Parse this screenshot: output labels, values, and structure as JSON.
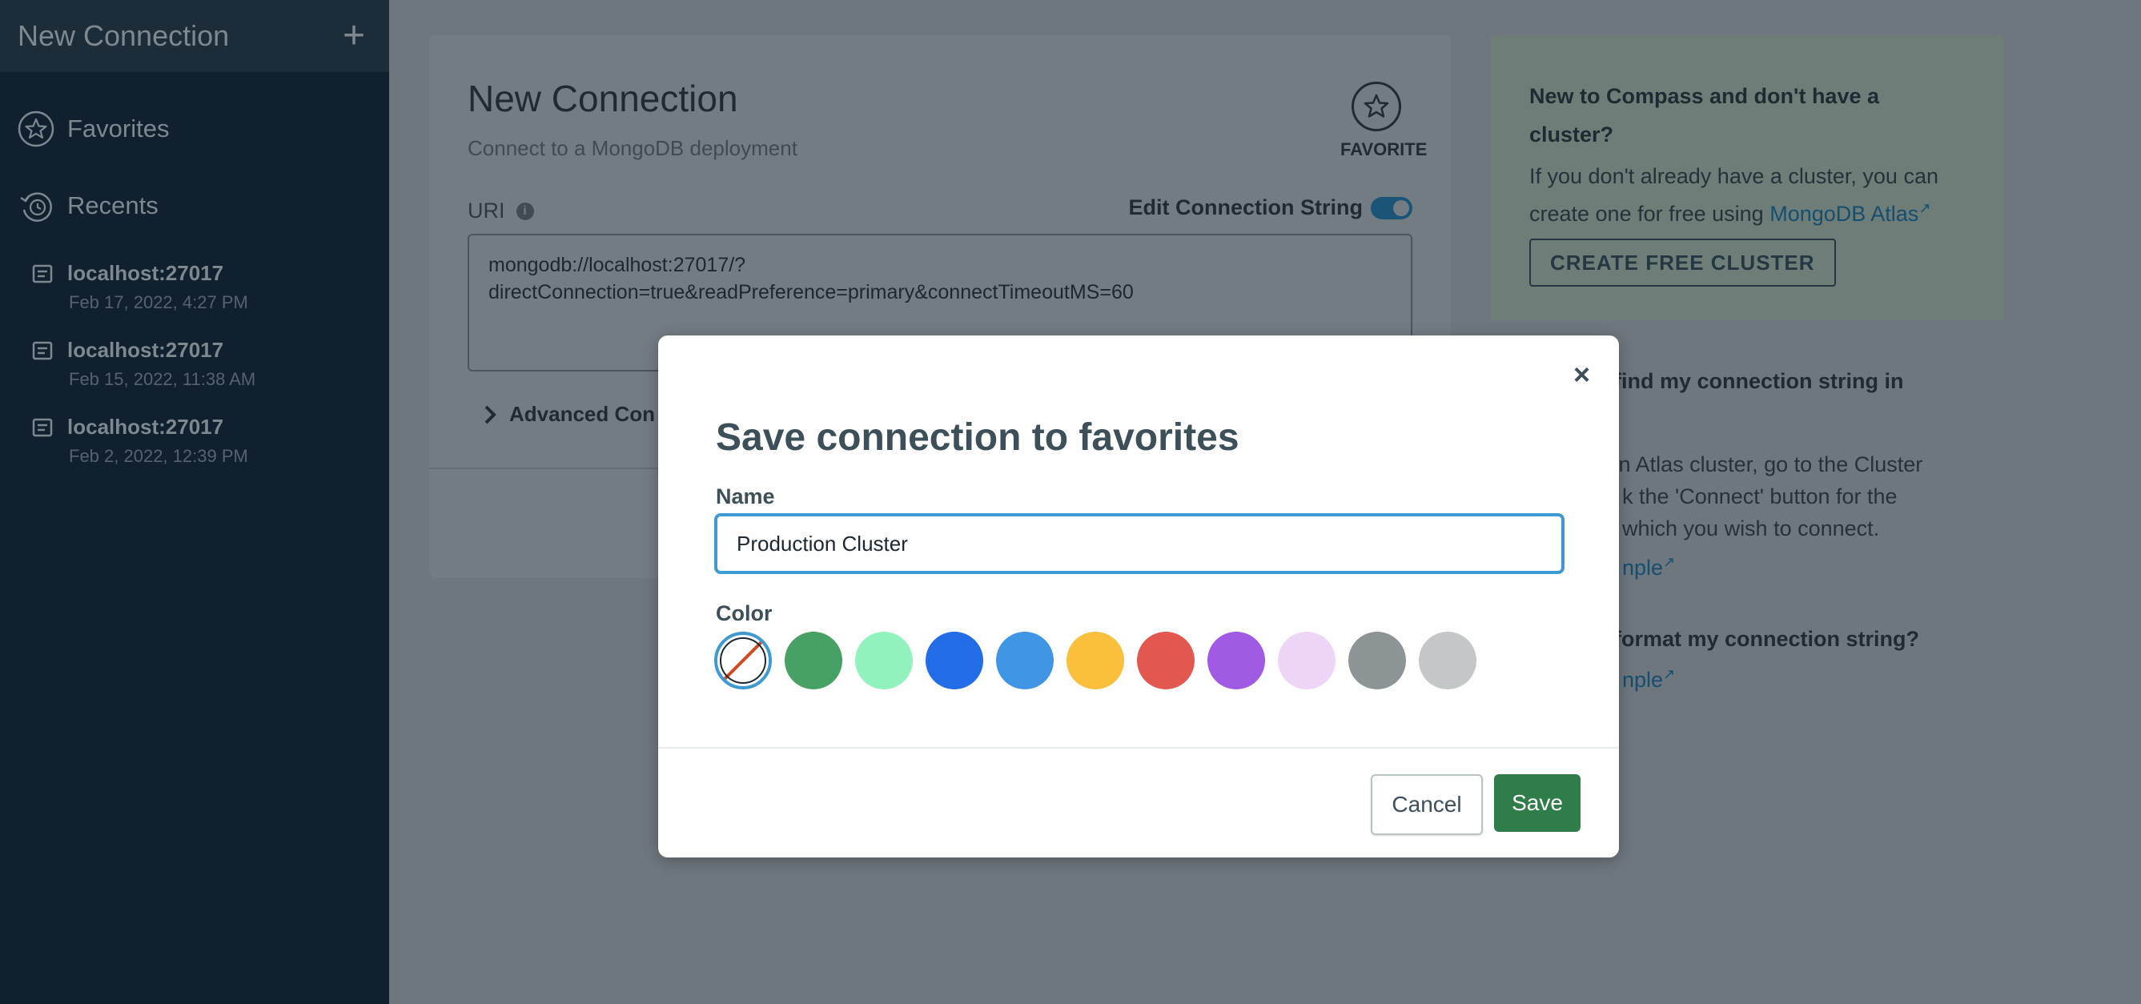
{
  "sidebar": {
    "title": "New Connection",
    "plus_icon": "+",
    "favorites_label": "Favorites",
    "recents_label": "Recents",
    "recents": [
      {
        "host": "localhost:27017",
        "date": "Feb 17, 2022, 4:27 PM"
      },
      {
        "host": "localhost:27017",
        "date": "Feb 15, 2022, 11:38 AM"
      },
      {
        "host": "localhost:27017",
        "date": "Feb 2, 2022, 12:39 PM"
      }
    ]
  },
  "connect": {
    "title": "New Connection",
    "subtitle": "Connect to a MongoDB deployment",
    "favorite_label": "FAVORITE",
    "uri_label": "URI",
    "info_glyph": "i",
    "edit_cs_label": "Edit Connection String",
    "uri_line1": "mongodb://localhost:27017/?",
    "uri_line2": "directConnection=true&readPreference=primary&connectTimeoutMS=60",
    "advanced_label": "Advanced Con"
  },
  "help": {
    "new_heading": "New to Compass and don't have a cluster?",
    "new_text": "If you don't already have a cluster, you can create one for free using",
    "atlas_link": "MongoDB Atlas",
    "create_button": "CREATE FREE CLUSTER",
    "q1_line1": "find my connection string in",
    "a1_line1": "e an Atlas cluster, go to the Cluster",
    "a1_line2": "k the 'Connect' button for the",
    "a1_line3": "which you wish to connect.",
    "a1_link": "nple",
    "q2_line1": "format my connection string?",
    "a2_link": "nple"
  },
  "modal": {
    "title": "Save connection to favorites",
    "close_glyph": "×",
    "name_label": "Name",
    "name_value": "Production Cluster",
    "color_label": "Color",
    "colors": [
      "none",
      "#47a064",
      "#92f2be",
      "#226de7",
      "#3f96e5",
      "#f9bf3d",
      "#e2574e",
      "#a05ae4",
      "#ecd5f6",
      "#8c9496",
      "#c3c7c7"
    ],
    "selected_color": "none",
    "cancel_label": "Cancel",
    "save_label": "Save"
  }
}
